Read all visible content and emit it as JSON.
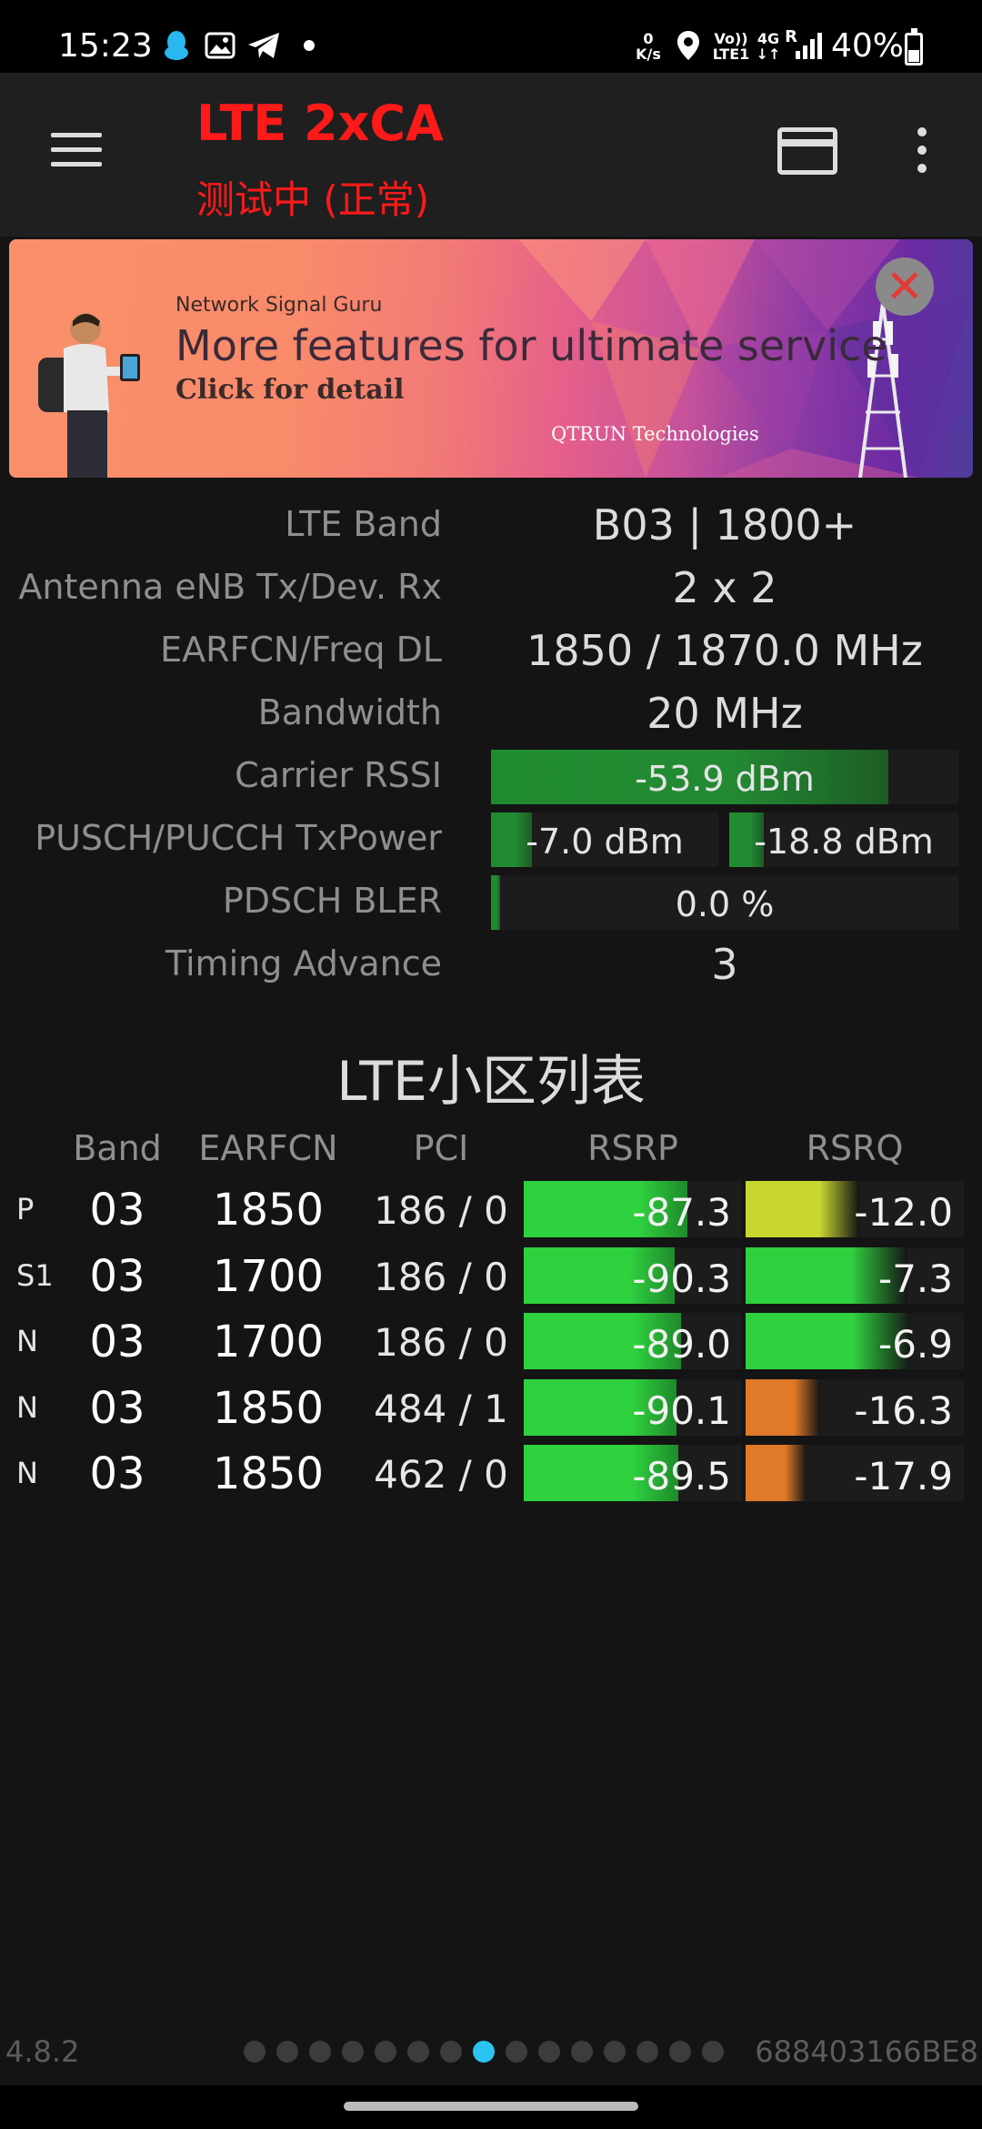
{
  "status_bar": {
    "time": "15:23",
    "net_speed_value": "0",
    "net_speed_unit": "K/s",
    "volte_top": "Vo))",
    "volte_bottom": "LTE1",
    "network_type": "4G",
    "roaming": "R",
    "battery": "40%"
  },
  "toolbar": {
    "title": "LTE 2xCA",
    "subtitle": "测试中 (正常)"
  },
  "ad": {
    "brand": "Network Signal Guru",
    "headline": "More features for ultimate service",
    "cta": "Click for detail",
    "company": "QTRUN Technologies",
    "close_glyph": "✕"
  },
  "info": {
    "lte_band": {
      "label": "LTE Band",
      "value": "B03 | 1800+"
    },
    "antenna": {
      "label": "Antenna eNB Tx/Dev. Rx",
      "value": "2 x 2"
    },
    "earfcn": {
      "label": "EARFCN/Freq DL",
      "value": "1850 / 1870.0 MHz"
    },
    "bandwidth": {
      "label": "Bandwidth",
      "value": "20 MHz"
    },
    "rssi": {
      "label": "Carrier RSSI",
      "value": "-53.9 dBm",
      "fill_fraction": 0.85
    },
    "txpower": {
      "label": "PUSCH/PUCCH TxPower",
      "pusch": "-7.0 dBm",
      "pusch_fill_fraction": 0.18,
      "pucch": "-18.8 dBm",
      "pucch_fill_fraction": 0.15
    },
    "bler": {
      "label": "PDSCH BLER",
      "value": "0.0 %",
      "fill_fraction": 0.02
    },
    "timing_advance": {
      "label": "Timing Advance",
      "value": "3"
    }
  },
  "cell_list": {
    "title": "LTE小区列表",
    "headers": {
      "band": "Band",
      "earfcn": "EARFCN",
      "pci": "PCI",
      "rsrp": "RSRP",
      "rsrq": "RSRQ"
    },
    "rows": [
      {
        "type": "P",
        "band": "03",
        "earfcn": "1850",
        "pci": "186 / 0",
        "rsrp": "-87.3",
        "rsrp_fill": 0.75,
        "rsrp_color": "#2fd13f",
        "rsrq": "-12.0",
        "rsrq_fill": 0.52,
        "rsrq_color": "#c8d631"
      },
      {
        "type": "S1",
        "band": "03",
        "earfcn": "1700",
        "pci": "186 / 0",
        "rsrp": "-90.3",
        "rsrp_fill": 0.69,
        "rsrp_color": "#2fd13f",
        "rsrq": "-7.3",
        "rsrq_fill": 0.74,
        "rsrq_color": "#2fd13f"
      },
      {
        "type": "N",
        "band": "03",
        "earfcn": "1700",
        "pci": "186 / 0",
        "rsrp": "-89.0",
        "rsrp_fill": 0.72,
        "rsrp_color": "#2fd13f",
        "rsrq": "-6.9",
        "rsrq_fill": 0.76,
        "rsrq_color": "#2fd13f"
      },
      {
        "type": "N",
        "band": "03",
        "earfcn": "1850",
        "pci": "484 / 1",
        "rsrp": "-90.1",
        "rsrp_fill": 0.7,
        "rsrp_color": "#2fd13f",
        "rsrq": "-16.3",
        "rsrq_fill": 0.34,
        "rsrq_color": "#e07a28"
      },
      {
        "type": "N",
        "band": "03",
        "earfcn": "1850",
        "pci": "462 / 0",
        "rsrp": "-89.5",
        "rsrp_fill": 0.71,
        "rsrp_color": "#2fd13f",
        "rsrq": "-17.9",
        "rsrq_fill": 0.28,
        "rsrq_color": "#e07a28"
      }
    ]
  },
  "footer": {
    "version": "4.8.2",
    "device_id": "688403166BE8",
    "page_count": 15,
    "active_page": 8
  }
}
